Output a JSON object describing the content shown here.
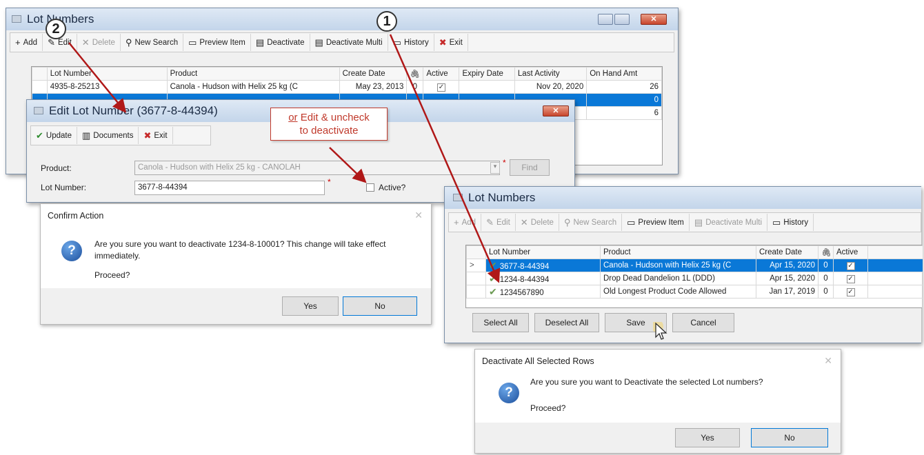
{
  "main_window": {
    "title": "Lot Numbers",
    "toolbar": [
      {
        "label": "Add",
        "icon": "+",
        "disabled": false
      },
      {
        "label": "Edit",
        "icon": "✎",
        "disabled": false
      },
      {
        "label": "Delete",
        "icon": "✕",
        "disabled": true
      },
      {
        "label": "New Search",
        "icon": "⚲",
        "disabled": false
      },
      {
        "label": "Preview Item",
        "icon": "▭",
        "disabled": false
      },
      {
        "label": "Deactivate",
        "icon": "▤",
        "disabled": false
      },
      {
        "label": "Deactivate Multi",
        "icon": "▤",
        "disabled": false
      },
      {
        "label": "History",
        "icon": "▭",
        "disabled": false
      },
      {
        "label": "Exit",
        "icon": "✖",
        "disabled": false
      }
    ],
    "columns": [
      "Lot Number",
      "Product",
      "Create Date",
      "🖇",
      "Active",
      "Expiry Date",
      "Last Activity",
      "On Hand Amt"
    ],
    "rows": [
      {
        "lot": "4935-8-25213",
        "product": "Canola - Hudson with Helix 25 kg (C",
        "create": "May 23, 2013",
        "att": "0",
        "active": "✓",
        "expiry": "",
        "last": "Nov 20, 2020",
        "onhand": "26"
      }
    ],
    "partial_values": [
      "0",
      "6"
    ]
  },
  "edit_window": {
    "title": "Edit Lot Number (3677-8-44394)",
    "toolbar": [
      {
        "label": "Update",
        "icon": "✔"
      },
      {
        "label": "Documents",
        "icon": "▥"
      },
      {
        "label": "Exit",
        "icon": "✖"
      }
    ],
    "product_label": "Product:",
    "product_value": "Canola - Hudson with Helix 25 kg - CANOLAH",
    "find_label": "Find",
    "lot_label": "Lot Number:",
    "lot_value": "3677-8-44394",
    "active_label": "Active?"
  },
  "confirm_dialog": {
    "title": "Confirm Action",
    "message": "Are you sure you want to deactivate 1234-8-10001?  This change will take effect immediately.",
    "proceed": "Proceed?",
    "yes": "Yes",
    "no": "No"
  },
  "multi_window": {
    "title": "Lot Numbers",
    "toolbar": [
      {
        "label": "Add",
        "icon": "+",
        "disabled": true
      },
      {
        "label": "Edit",
        "icon": "✎",
        "disabled": true
      },
      {
        "label": "Delete",
        "icon": "✕",
        "disabled": true
      },
      {
        "label": "New Search",
        "icon": "⚲",
        "disabled": true
      },
      {
        "label": "Preview Item",
        "icon": "▭",
        "disabled": false
      },
      {
        "label": "Deactivate Multi",
        "icon": "▤",
        "disabled": true
      },
      {
        "label": "History",
        "icon": "▭",
        "disabled": false
      }
    ],
    "columns": [
      "Lot Number",
      "Product",
      "Create Date",
      "🖇",
      "Active"
    ],
    "rows": [
      {
        "lot": "3677-8-44394",
        "product": "Canola - Hudson with Helix 25 kg (C",
        "create": "Apr 15, 2020",
        "att": "0",
        "active": "✓"
      },
      {
        "lot": "1234-8-44394",
        "product": "Drop Dead Dandelion 1L (DDD)",
        "create": "Apr 15, 2020",
        "att": "0",
        "active": "✓"
      },
      {
        "lot": "1234567890",
        "product": "Old Longest Product Code Allowed",
        "create": "Jan 17, 2019",
        "att": "0",
        "active": "✓"
      }
    ],
    "select_all": "Select All",
    "deselect_all": "Deselect All",
    "save": "Save",
    "cancel": "Cancel"
  },
  "deactivate_dialog": {
    "title": "Deactivate All Selected Rows",
    "message": "Are you sure you want to Deactivate the selected Lot numbers?",
    "proceed": "Proceed?",
    "yes": "Yes",
    "no": "No"
  },
  "callouts": {
    "one": "1",
    "two": "2",
    "note_line1_u": "or",
    "note_line1": " Edit & uncheck",
    "note_line2": "to deactivate"
  },
  "colors": {
    "selection": "#0a78d7",
    "callout_red": "#c0392b",
    "arrow": "#b01818"
  }
}
